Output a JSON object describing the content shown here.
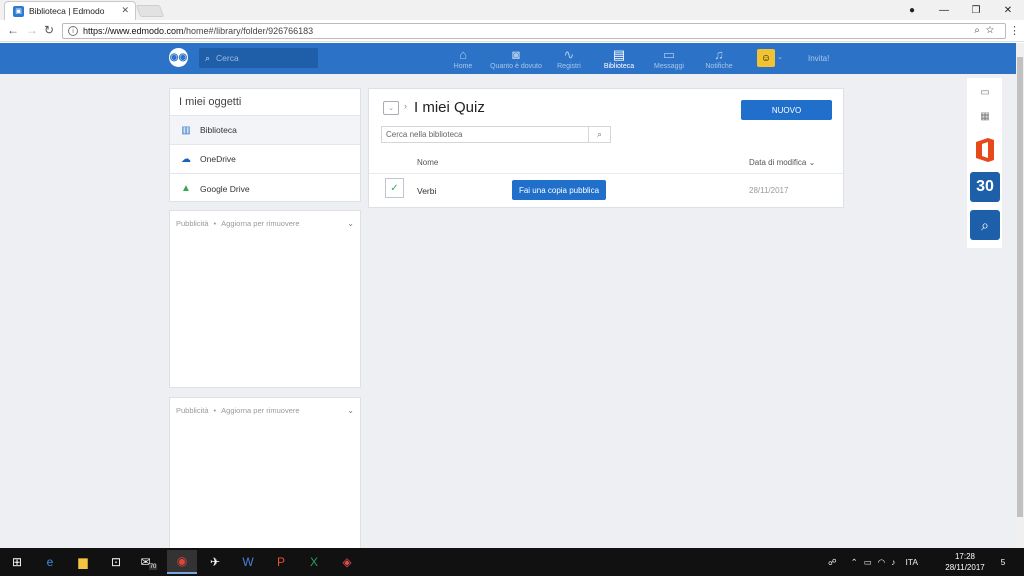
{
  "browser": {
    "tab_title": "Biblioteca | Edmodo",
    "url_host": "https://www.edmodo.com",
    "url_path": "/home#/library/folder/926766183"
  },
  "header": {
    "search_placeholder": "Cerca",
    "nav": [
      {
        "label": "Home",
        "icon": "home-icon"
      },
      {
        "label": "Quanto è dovuto",
        "icon": "camera-icon"
      },
      {
        "label": "Registri",
        "icon": "pulse-icon"
      },
      {
        "label": "Biblioteca",
        "icon": "library-icon",
        "active": true
      },
      {
        "label": "Messaggi",
        "icon": "chat-icon"
      },
      {
        "label": "Notifiche",
        "icon": "bell-icon"
      }
    ],
    "invite_label": "Invita!"
  },
  "sidebar": {
    "title": "I miei oggetti",
    "items": [
      {
        "label": "Biblioteca",
        "icon": "book-icon",
        "selected": true
      },
      {
        "label": "OneDrive",
        "icon": "onedrive-icon"
      },
      {
        "label": "Google Drive",
        "icon": "google-drive-icon"
      }
    ]
  },
  "ads": [
    {
      "label": "Pubblicità",
      "action": "Aggiorna per rimuovere"
    },
    {
      "label": "Pubblicità",
      "action": "Aggiorna per rimuovere"
    }
  ],
  "library": {
    "title": "I miei Quiz",
    "new_label": "NUOVO",
    "search_placeholder": "Cerca nella biblioteca",
    "columns": {
      "name": "Nome",
      "date": "Data di modifica"
    },
    "rows": [
      {
        "name": "Verbi",
        "action": "Fai una copia pubblica",
        "date": "28/11/2017"
      }
    ]
  },
  "apps": [
    {
      "icon": "store-icon"
    },
    {
      "icon": "apps-grid-icon"
    },
    {
      "icon": "office-icon"
    },
    {
      "icon": "calendar-icon",
      "label": "30"
    },
    {
      "icon": "quiz-check-icon"
    }
  ],
  "taskbar": {
    "badge": "70",
    "language": "ITA",
    "time": "17:28",
    "date": "28/11/2017",
    "notifications": "5"
  }
}
